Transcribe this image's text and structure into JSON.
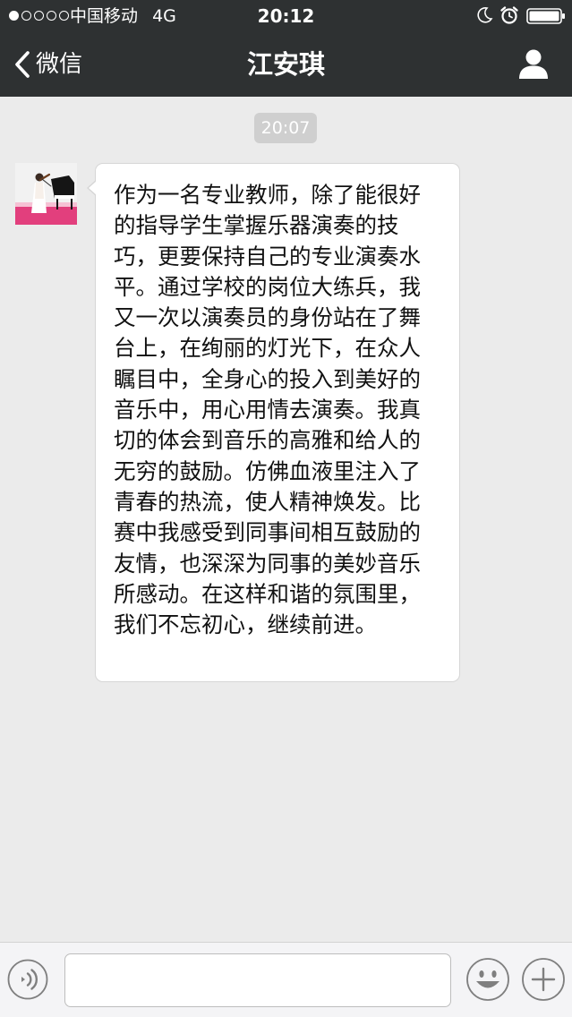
{
  "status_bar": {
    "signal_bars": 1,
    "signal_total": 5,
    "carrier": "中国移动",
    "network": "4G",
    "time": "20:12",
    "icons": [
      "moon-icon",
      "alarm-icon",
      "battery-icon"
    ]
  },
  "nav": {
    "back_label": "微信",
    "title": "江安琪",
    "right_icon": "profile-icon"
  },
  "chat": {
    "timestamp": "20:07",
    "messages": [
      {
        "sender_avatar": "avatar-photo",
        "text": "作为一名专业教师，除了能很好的指导学生掌握乐器演奏的技巧，更要保持自己的专业演奏水平。通过学校的岗位大练兵，我又一次以演奏员的身份站在了舞台上，在绚丽的灯光下，在众人瞩目中，全身心的投入到美好的音乐中，用心用情去演奏。我真切的体会到音乐的高雅和给人的无穷的鼓励。仿佛血液里注入了青春的热流，使人精神焕发。比赛中我感受到同事间相互鼓励的友情，也深深为同事的美妙音乐所感动。在这样和谐的氛围里，我们不忘初心，继续前进。"
      }
    ]
  },
  "input_bar": {
    "value": "",
    "icons": [
      "voice-icon",
      "emoji-icon",
      "plus-icon"
    ]
  },
  "colors": {
    "topbar_bg": "#2e3132",
    "chat_bg": "#ebebeb",
    "bubble_bg": "#ffffff",
    "timestamp_bg": "#cfcfcf",
    "input_bar_bg": "#f4f4f6"
  }
}
